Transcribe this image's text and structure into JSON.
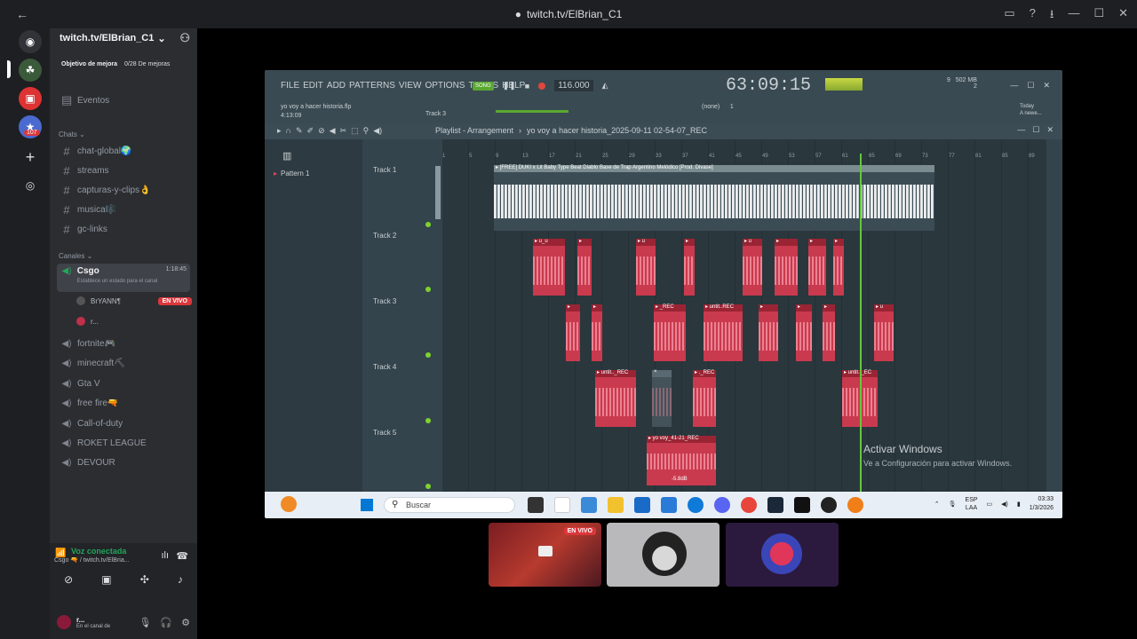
{
  "window": {
    "title": "twitch.tv/ElBrian_C1"
  },
  "guild": {
    "name": "twitch.tv/ElBrian_C1",
    "goal_label": "Objetivo de mejora",
    "goal_progress": "0/28 De mejoras",
    "events": "Eventos"
  },
  "chats_category": "Chats",
  "text_channels": [
    {
      "name": "chat-global🌍"
    },
    {
      "name": "streams"
    },
    {
      "name": "capturas-y-clips👌"
    },
    {
      "name": "musica🎼"
    },
    {
      "name": "gc-links"
    }
  ],
  "voice_category": "Canales",
  "active_voice": {
    "name": "Csgo",
    "time": "1:18:45",
    "status": "Establece un estado para el canal"
  },
  "voice_users": [
    {
      "name": "BrYANN¶",
      "badge": "EN VIVO"
    },
    {
      "name": "r..."
    }
  ],
  "voice_channels": [
    {
      "name": "fortnite🎮"
    },
    {
      "name": "minecraft⛏"
    },
    {
      "name": "Gta V"
    },
    {
      "name": "free fire🔫"
    },
    {
      "name": "Call-of-duty"
    },
    {
      "name": "ROKET LEAGUE"
    },
    {
      "name": "DEVOUR"
    }
  ],
  "voice_panel": {
    "title": "Voz conectada",
    "subtitle": "Csgo 🔫 / twitch.tv/ElBria...",
    "user": "r...",
    "user_status": "En el canal de"
  },
  "server_badge": "107",
  "fl": {
    "menu": [
      "FILE",
      "EDIT",
      "ADD",
      "PATTERNS",
      "VIEW",
      "OPTIONS",
      "TOOLS",
      "HELP"
    ],
    "file_name": "yo voy a hacer historia.flp",
    "file_time": "4:13:09",
    "track_hint": "Track 3",
    "song": "SONG",
    "tempo": "116.000",
    "time": "63:09:15",
    "memory": "502 MB",
    "voices": "9",
    "cpu_extra": "2",
    "pattern_none": "(none)",
    "pattern_num": "1",
    "today": "Today",
    "today_sub": "A newe...",
    "playlist_title": "Playlist - Arrangement",
    "playlist_file": "yo voy a hacer historia_2025-09-11 02-54-07_REC",
    "pattern_item": "Pattern 1",
    "tracks": [
      "Track 1",
      "Track 2",
      "Track 3",
      "Track 4",
      "Track 5"
    ],
    "ruler": [
      "1",
      "5",
      "9",
      "13",
      "17",
      "21",
      "25",
      "29",
      "33",
      "37",
      "41",
      "45",
      "49",
      "53",
      "57",
      "61",
      "65",
      "69",
      "73",
      "77",
      "81",
      "85",
      "89"
    ],
    "clip_audio": "▸ [FREE] DUKI x Lit Baby Type Beat Diablo  Base de Trap Argentino Melódico [Prod. Divase]",
    "clip_t2": [
      "▸ u_u",
      "▸",
      "▸ u",
      "▸",
      "▸ u",
      "▸",
      "▸",
      "▸"
    ],
    "clip_t3": [
      "▸",
      "▸",
      "▸ _REC",
      "▸ untit..REC",
      "▸",
      "▸",
      "▸",
      "▸ u"
    ],
    "clip_t4": [
      "▸ untit.._REC",
      "×",
      "▸ ._REC",
      "▸ untit.._EC"
    ],
    "clip_t5": "▸ yo voy_41-21_REC",
    "clip_t5_gain": "-5.8dB",
    "watermark_title": "Activar Windows",
    "watermark_sub": "Ve a Configuración para activar Windows."
  },
  "taskbar": {
    "search": "Buscar",
    "lang": "ESP",
    "lang_sub": "LAA",
    "time": "03:33",
    "date": "1/3/2026"
  },
  "tiles": {
    "live": "EN VIVO"
  }
}
